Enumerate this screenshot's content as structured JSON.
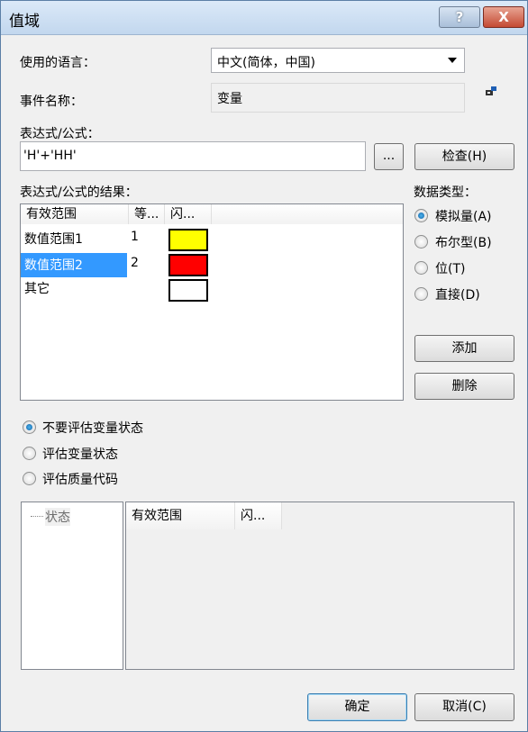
{
  "window": {
    "title": "值域",
    "help_label": "?",
    "close_label": "X"
  },
  "language": {
    "label": "使用的语言：",
    "value": "中文(简体，中国)"
  },
  "event": {
    "label": "事件名称：",
    "value": "变量"
  },
  "expression": {
    "label": "表达式/公式：",
    "value": "'H'+'HH'",
    "browse_label": "...",
    "check_label": "检查(H)"
  },
  "results": {
    "label": "表达式/公式的结果：",
    "columns": [
      "有效范围",
      "等...",
      "闪..."
    ],
    "rows": [
      {
        "range": "数值范围1",
        "eq": "1",
        "color": "#ffff00"
      },
      {
        "range": "数值范围2",
        "eq": "2",
        "color": "#ff0000"
      },
      {
        "range": "其它",
        "eq": "",
        "color": "#ffffff"
      }
    ]
  },
  "datatype": {
    "label": "数据类型：",
    "options": [
      "模拟量(A)",
      "布尔型(B)",
      "位(T)",
      "直接(D)"
    ],
    "selected": 0
  },
  "buttons": {
    "add": "添加",
    "delete": "删除",
    "ok": "确定",
    "cancel": "取消(C)"
  },
  "eval": {
    "options": [
      "不要评估变量状态",
      "评估变量状态",
      "评估质量代码"
    ],
    "selected": 0
  },
  "status_tree": {
    "item": "状态"
  },
  "status_table": {
    "columns": [
      "有效范围",
      "闪..."
    ]
  }
}
